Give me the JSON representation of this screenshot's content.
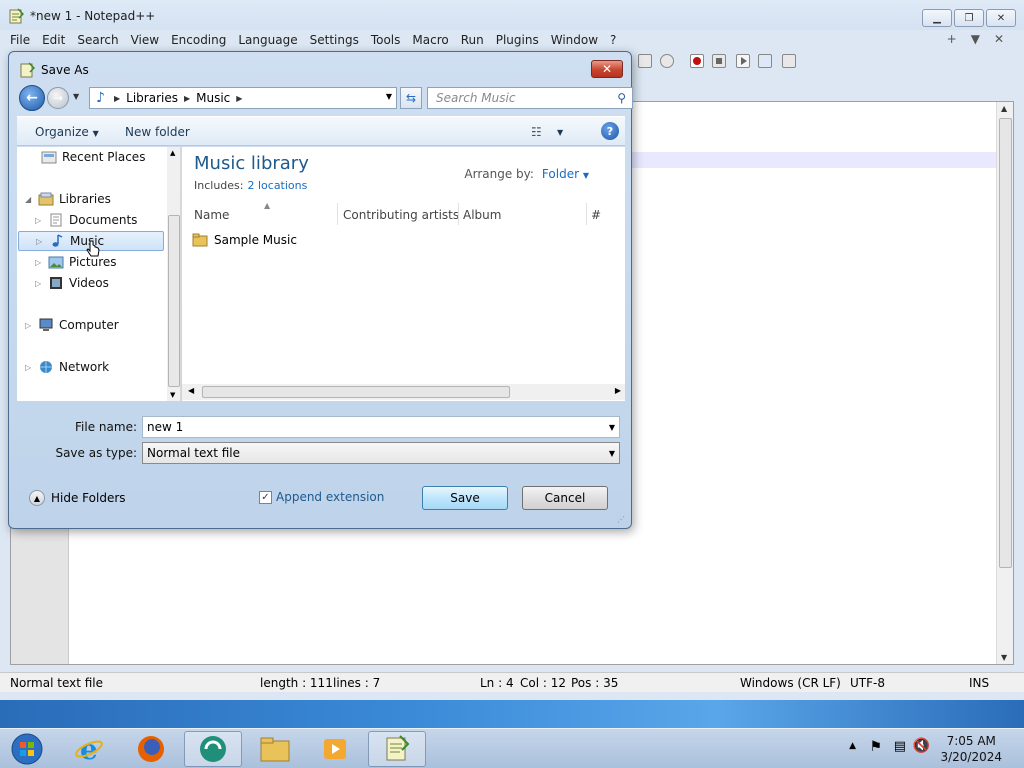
{
  "notepad": {
    "title": "*new 1 - Notepad++",
    "menu": [
      "File",
      "Edit",
      "Search",
      "View",
      "Encoding",
      "Language",
      "Settings",
      "Tools",
      "Macro",
      "Run",
      "Plugins",
      "Window",
      "?"
    ],
    "menu_right": [
      "+",
      "▼",
      "✕"
    ],
    "window_buttons": [
      "minimize-icon",
      "restore-icon",
      "close-icon"
    ],
    "status": {
      "type": "Normal text file",
      "length": "length : 111",
      "lines": "lines : 7",
      "ln": "Ln : 4",
      "col": "Col : 12",
      "pos": "Pos : 35",
      "eol": "Windows (CR LF)",
      "encoding": "UTF-8",
      "mode": "INS"
    }
  },
  "dialog": {
    "title": "Save As",
    "breadcrumb": [
      "Libraries",
      "Music"
    ],
    "search_placeholder": "Search Music",
    "organize_label": "Organize",
    "new_folder_label": "New folder",
    "nav_items": [
      {
        "label": "Recent Places",
        "icon": "recent-places-icon"
      },
      {
        "label": "Libraries",
        "icon": "libraries-icon"
      },
      {
        "label": "Documents",
        "icon": "documents-icon"
      },
      {
        "label": "Music",
        "icon": "music-icon"
      },
      {
        "label": "Pictures",
        "icon": "pictures-icon"
      },
      {
        "label": "Videos",
        "icon": "videos-icon"
      },
      {
        "label": "Computer",
        "icon": "computer-icon"
      },
      {
        "label": "Network",
        "icon": "network-icon"
      }
    ],
    "library_title": "Music library",
    "includes_label": "Includes:",
    "includes_link": "2 locations",
    "arrange_label": "Arrange by:",
    "arrange_value": "Folder",
    "columns": [
      "Name",
      "Contributing artists",
      "Album",
      "#"
    ],
    "files": [
      {
        "name": "Sample Music",
        "icon": "folder-icon"
      }
    ],
    "file_name_label": "File name:",
    "file_name_value": "new 1",
    "save_type_label": "Save as type:",
    "save_type_value": "Normal text file",
    "hide_folders_label": "Hide Folders",
    "append_extension_label": "Append extension",
    "append_extension_checked": true,
    "save_label": "Save",
    "cancel_label": "Cancel"
  },
  "taskbar": {
    "time": "7:05 AM",
    "date": "3/20/2024",
    "apps": [
      "start-orb-icon",
      "internet-explorer-icon",
      "firefox-icon",
      "app-icon",
      "file-explorer-icon",
      "media-player-icon",
      "notepad-plus-plus-icon"
    ]
  },
  "colors": {
    "accent": "#1e5a8c",
    "link": "#1a6cc0",
    "close_red": "#c8452e",
    "selected_bg": "#cfe3f8"
  }
}
